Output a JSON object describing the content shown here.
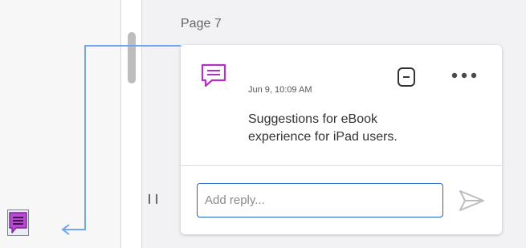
{
  "comments_panel": {
    "page_label": "Page 7",
    "comment": {
      "icon": "comment-icon",
      "timestamp": "Jun 9, 10:09 AM",
      "text": "Suggestions for eBook experience for iPad users.",
      "resolve_icon": "resolve-icon",
      "more_icon": "more-options-icon"
    },
    "reply": {
      "value": "",
      "placeholder": "Add reply...",
      "send_icon": "send-icon"
    },
    "resize_handle_icon": "resize-handle-icon"
  },
  "document": {
    "annotation_marker_icon": "comment-marker-icon"
  },
  "colors": {
    "accent_magenta": "#b42fc6",
    "marker_fill": "#b84ad1",
    "connector_blue": "#6fa5f2",
    "input_border": "#1f63c4"
  }
}
